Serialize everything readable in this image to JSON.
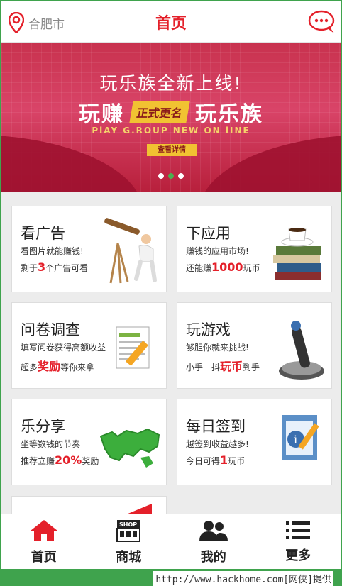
{
  "header": {
    "city": "合肥市",
    "title": "首页",
    "message_icon": "chat-bubble-icon"
  },
  "banner": {
    "line1": "玩乐族全新上线!",
    "line2_left": "玩赚",
    "line2_tag": "正式更名",
    "line2_right": "玩乐族",
    "line3": "PlAY G.ROUP NEW ON lINE",
    "button": "查看详情",
    "dots": 3,
    "active_dot": 1
  },
  "cards": [
    {
      "title": "看广告",
      "sub1": "看图片就能赚钱!",
      "sub2_pre": "剩于",
      "sub2_hl": "3",
      "sub2_post": "个广告可看",
      "icon": "telescope-icon"
    },
    {
      "title": "下应用",
      "sub1": "赚钱的应用市场!",
      "sub2_pre": "还能赚",
      "sub2_hl": "1000",
      "sub2_post": "玩币",
      "icon": "books-coffee-icon"
    },
    {
      "title": "问卷调查",
      "sub1": "填写问卷获得高额收益",
      "sub2_pre": "超多",
      "sub2_hl": "奖励",
      "sub2_post": "等你来拿",
      "icon": "document-pencil-icon"
    },
    {
      "title": "玩游戏",
      "sub1": "够胆你就来挑战!",
      "sub2_pre": "小手一抖",
      "sub2_hl": "玩币",
      "sub2_post": "到手",
      "icon": "joystick-icon"
    },
    {
      "title": "乐分享",
      "sub1": "坐等数钱的节奏",
      "sub2_pre": "推荐立赚",
      "sub2_hl": "20%",
      "sub2_post": "奖励",
      "icon": "world-map-icon"
    },
    {
      "title": "每日签到",
      "sub1": "越签到收益越多!",
      "sub2_pre": "今日可得",
      "sub2_hl": "1",
      "sub2_post": "玩币",
      "icon": "signin-document-icon"
    }
  ],
  "tabs": [
    {
      "label": "首页",
      "icon": "home-icon",
      "active": true
    },
    {
      "label": "商城",
      "icon": "shop-icon",
      "badge": "SHOP"
    },
    {
      "label": "我的",
      "icon": "users-icon"
    },
    {
      "label": "更多",
      "icon": "list-icon"
    }
  ],
  "watermark": "http://www.hackhome.com[网侠]提供",
  "colors": {
    "accent": "#e4202a",
    "green": "#3fa34d",
    "banner": "#c8324e"
  }
}
